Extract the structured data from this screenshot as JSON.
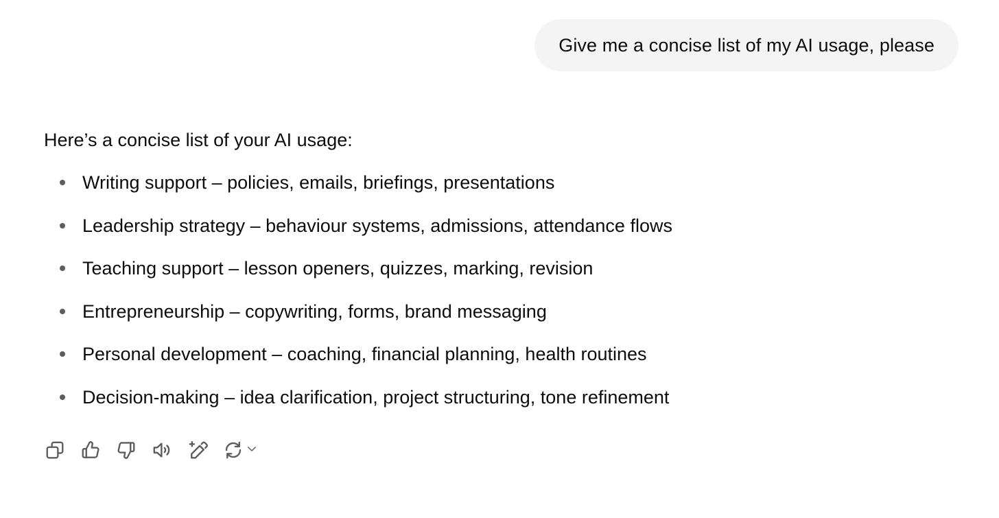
{
  "user_message": {
    "text": "Give me a concise list of my AI usage, please"
  },
  "assistant_message": {
    "intro": "Here’s a concise list of your AI usage:",
    "items": [
      {
        "label": "Writing support – policies, emails, briefings, presentations"
      },
      {
        "label": "Leadership strategy – behaviour systems, admissions, attendance flows"
      },
      {
        "label": "Teaching support – lesson openers, quizzes, marking, revision"
      },
      {
        "label": "Entrepreneurship – copywriting, forms, brand messaging"
      },
      {
        "label": "Personal development – coaching, financial planning, health routines"
      },
      {
        "label": "Decision-making – idea clarification, project structuring, tone refinement"
      }
    ]
  },
  "actions": {
    "icons": [
      "copy-icon",
      "thumbs-up-icon",
      "thumbs-down-icon",
      "read-aloud-icon",
      "edit-sparkle-icon",
      "regenerate-icon",
      "chevron-down-icon"
    ]
  },
  "colors": {
    "text": "#0d0d0d",
    "bubble_bg": "#f4f4f4",
    "icon": "#5d5d5d",
    "bullet": "#5d5d5d"
  }
}
